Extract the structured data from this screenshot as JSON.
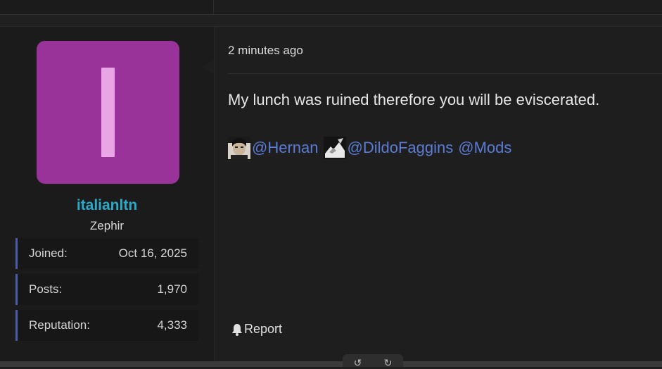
{
  "post": {
    "timestamp": "2 minutes ago",
    "message": "My lunch was ruined therefore you will be eviscerated.",
    "mentions": [
      {
        "handle": "@Hernan",
        "avatar_icon": "user-avatar-thumbnail"
      },
      {
        "handle": "@DildoFaggins",
        "avatar_icon": "user-avatar-thumbnail"
      },
      {
        "handle": "@Mods"
      }
    ],
    "report_label": "Report"
  },
  "author": {
    "avatar_letter": "I",
    "avatar_color": "#993399",
    "username": "italianltn",
    "title": "Zephir",
    "stats": [
      {
        "label": "Joined:",
        "value": "Oct 16, 2025"
      },
      {
        "label": "Posts:",
        "value": "1,970"
      },
      {
        "label": "Reputation:",
        "value": "4,333"
      }
    ]
  },
  "colors": {
    "username": "#2aa9c8",
    "mention": "#5b7bd5",
    "stat_accent": "#4d5caa"
  },
  "toolbar": {
    "icons": [
      "rotate-left-icon",
      "rotate-right-icon"
    ]
  }
}
